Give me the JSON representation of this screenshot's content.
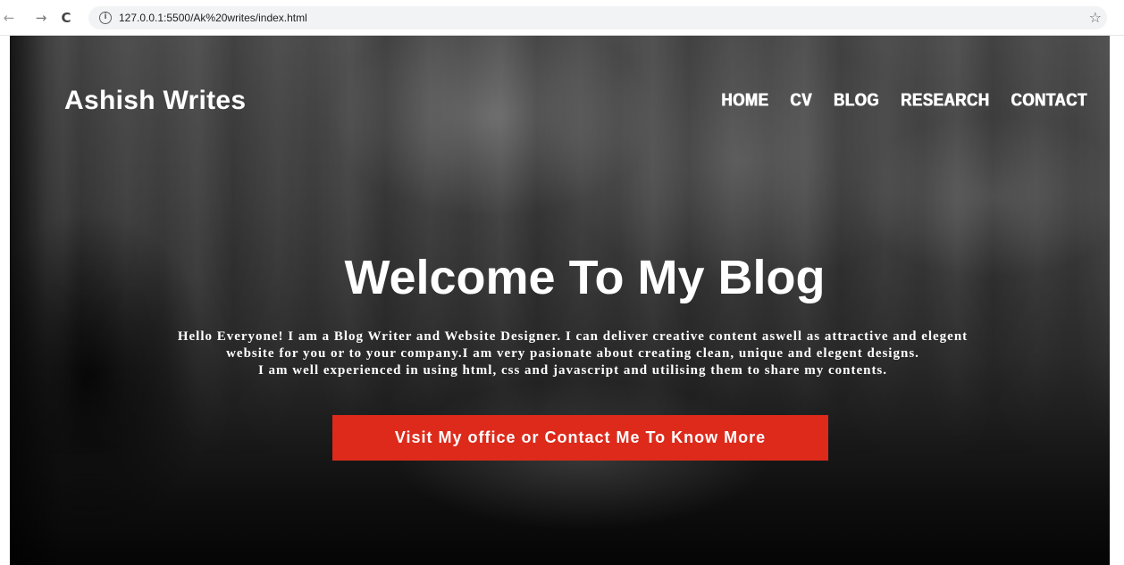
{
  "browser": {
    "url": "127.0.0.1:5500/Ak%20writes/index.html",
    "back_icon": "←",
    "forward_icon": "→",
    "reload_icon": "C",
    "info_icon": "i",
    "bookmark_icon": "☆"
  },
  "site": {
    "logo": "Ashish Writes",
    "nav": [
      "HOME",
      "CV",
      "BLOG",
      "RESEARCH",
      "CONTACT"
    ]
  },
  "hero": {
    "title": "Welcome To My Blog",
    "lines": [
      "Hello Everyone! I am a Blog Writer and Website Designer. I can deliver creative content aswell as attractive and elegent",
      "website for you or to your company.I am very pasionate about creating clean, unique and elegent designs.",
      "I am well experienced in using html, css and javascript and utilising them to share my contents."
    ],
    "cta_label": "Visit My office or Contact Me To Know More"
  },
  "colors": {
    "cta_background": "#dd2a1b",
    "text": "#ffffff"
  }
}
